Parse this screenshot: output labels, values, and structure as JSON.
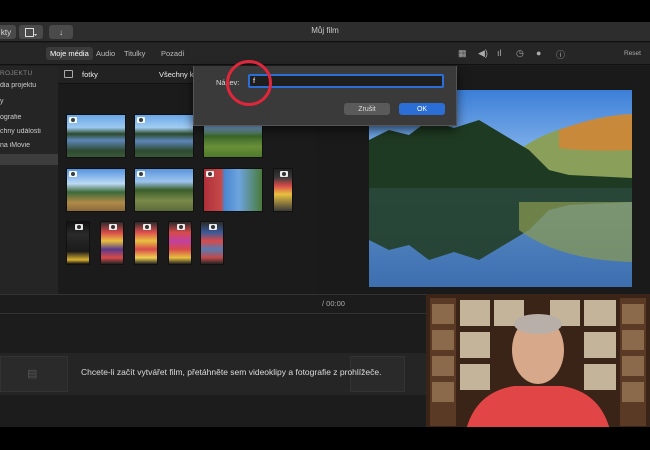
{
  "window": {
    "title": "Můj film"
  },
  "titlebar": {
    "left_button": "kty"
  },
  "toolbar": {
    "tabs": [
      {
        "label": "Moje média",
        "active": true
      },
      {
        "label": "Audio",
        "active": false
      },
      {
        "label": "Titulky",
        "active": false
      },
      {
        "label": "Pozadí",
        "active": false
      }
    ],
    "right_label": "Reset"
  },
  "sidebar": {
    "heading": "ROJEKTU",
    "items": [
      {
        "label": "dia projektu",
        "selected": false
      },
      {
        "label": "y",
        "selected": false
      },
      {
        "label": "ografie",
        "selected": false
      },
      {
        "label": "chny události",
        "selected": false
      },
      {
        "label": "na iMovie",
        "selected": false
      },
      {
        "label": "",
        "selected": true
      }
    ]
  },
  "browser": {
    "title": "fotky",
    "filter": "Všechny k"
  },
  "dialog": {
    "name_label": "Název:",
    "name_value": "f",
    "cancel_label": "Zrušit",
    "ok_label": "OK"
  },
  "timeline": {
    "timecode": "/ 00:00",
    "hint": "Chcete-li začít vytvářet film, přetáhněte sem videoklipy a fotografie z prohlížeče."
  },
  "colors": {
    "accent": "#2b6fd6",
    "annotation": "#e0263a",
    "webcam_shirt": "#e24545"
  }
}
